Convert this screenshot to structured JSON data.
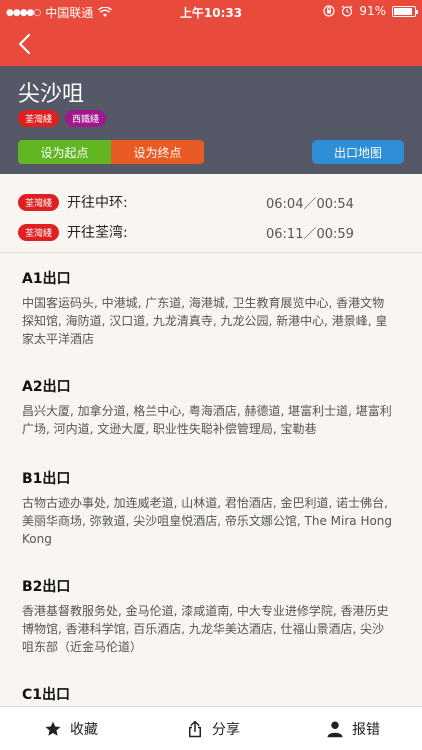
{
  "status_bar": {
    "carrier": "中国联通",
    "time": "上午10:33",
    "battery": "91%",
    "battery_level": 0.91
  },
  "station": {
    "name": "尖沙咀",
    "tags": [
      "荃灣綫",
      "西鐵綫"
    ]
  },
  "buttons": {
    "set_start": "设为起点",
    "set_end": "设为终点",
    "exit_map": "出口地图"
  },
  "schedule": [
    {
      "line": "荃灣綫",
      "direction": "开往中环:",
      "times": "06:04／00:54"
    },
    {
      "line": "荃灣綫",
      "direction": "开往荃湾:",
      "times": "06:11／00:59"
    }
  ],
  "exits": [
    {
      "title": "A1出口",
      "desc": "中国客运码头, 中港城, 广东道, 海港城, 卫生教育展览中心, 香港文物探知馆, 海防道, 汉口道, 九龙清真寺, 九龙公园, 新港中心, 港景峰, 皇家太平洋酒店"
    },
    {
      "title": "A2出口",
      "desc": "昌兴大厦, 加拿分道, 格兰中心, 粤海酒店, 赫德道, 堪富利士道, 堪富利广场, 河内道, 文逊大厦, 职业性失聪补偿管理局, 宝勒巷"
    },
    {
      "title": "B1出口",
      "desc": "古物古迹办事处, 加连威老道, 山林道, 君怡酒店, 金巴利道, 诺士佛台, 美丽华商场, 弥敦道, 尖沙咀皇悦酒店, 帝乐文娜公馆, The Mira Hong Kong"
    },
    {
      "title": "B2出口",
      "desc": "香港基督教服务处, 金马伦道, 漆咸道南, 中大专业进修学院, 香港历史博物馆, 香港科学馆, 百乐酒店, 九龙华美达酒店, 仕福山景酒店, 尖沙咀东部（近金马伦道）"
    },
    {
      "title": "C1出口",
      "desc": ""
    }
  ],
  "tab_bar": {
    "favorite": "收藏",
    "share": "分享",
    "report": "报错"
  },
  "colors": {
    "accent": "#e84a3b",
    "header": "#555866",
    "start": "#62b623",
    "end": "#ea5a24",
    "map": "#2e8fd8"
  }
}
